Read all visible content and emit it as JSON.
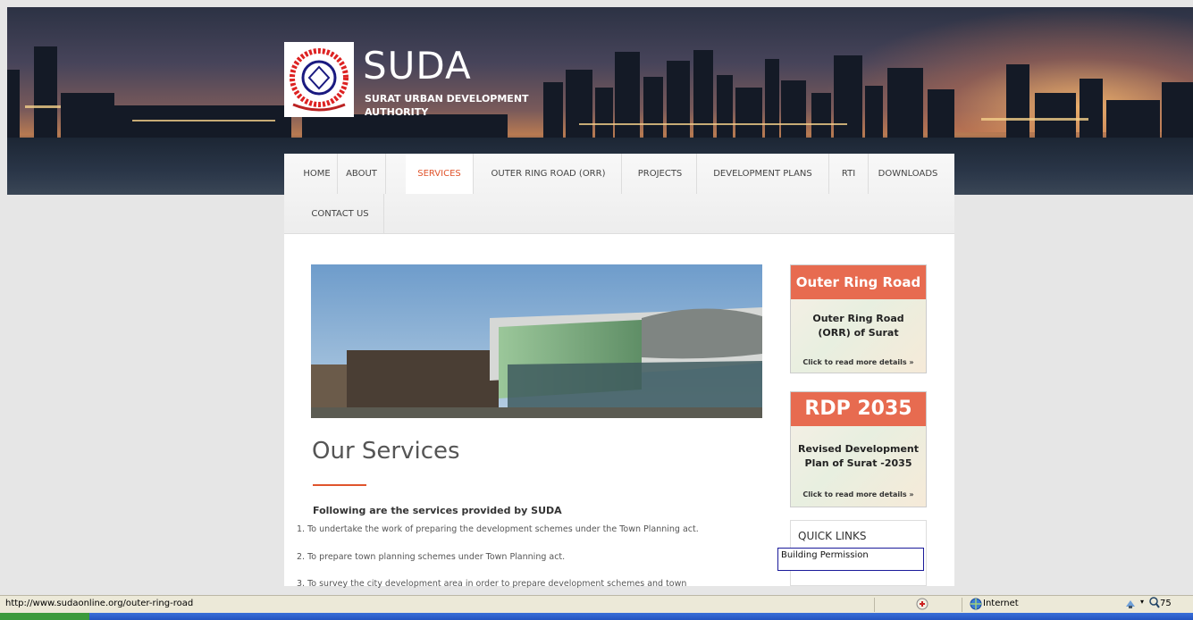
{
  "site": {
    "logo_title": "SUDA",
    "logo_subtitle": "SURAT URBAN DEVELOPMENT AUTHORITY"
  },
  "nav": {
    "items": [
      {
        "label": "HOME"
      },
      {
        "label": "ABOUT"
      },
      {
        "label": "SERVICES",
        "active": true
      },
      {
        "label": "OUTER RING ROAD (ORR)"
      },
      {
        "label": "PROJECTS"
      },
      {
        "label": "DEVELOPMENT PLANS"
      },
      {
        "label": "RTI"
      },
      {
        "label": "DOWNLOADS"
      },
      {
        "label": "CONTACT US"
      }
    ]
  },
  "main": {
    "title": "Our Services",
    "intro": "Following are the services provided by SUDA",
    "list": [
      "1. To undertake the work of preparing the development schemes under the Town Planning act.",
      "2. To prepare town planning schemes under Town Planning act.",
      "3. To survey the city development area in order to prepare development schemes and town"
    ]
  },
  "sidebar": {
    "orr": {
      "header": "Outer Ring Road",
      "body_line1": "Outer Ring Road",
      "body_line2": "(ORR) of Surat",
      "more": "Click to read more details »"
    },
    "rdp": {
      "header": "RDP 2035",
      "body_line1": "Revised Development",
      "body_line2": "Plan of Surat -2035",
      "more": "Click to read more details »"
    },
    "quick_links": {
      "title": "QUICK LINKS",
      "link": "Building Permission"
    }
  },
  "statusbar": {
    "url": "http://www.sudaonline.org/outer-ring-road",
    "zone": "Internet",
    "zoom": "75"
  },
  "colors": {
    "accent": "#e0542c",
    "card_header": "#e76b50"
  }
}
